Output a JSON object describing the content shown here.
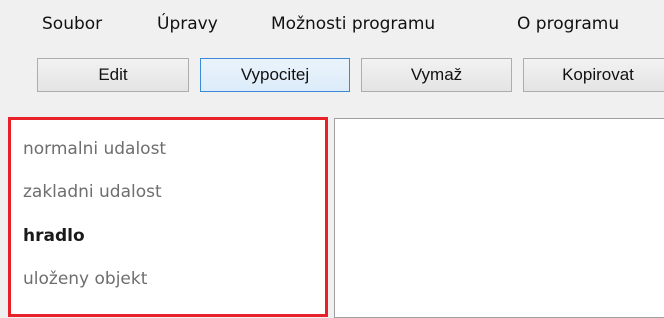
{
  "menubar": {
    "items": [
      {
        "label": "Soubor"
      },
      {
        "label": "Úpravy"
      },
      {
        "label": "Možnosti programu"
      },
      {
        "label": "O programu"
      }
    ]
  },
  "toolbar": {
    "buttons": [
      {
        "label": "Edit"
      },
      {
        "label": "Vypocitej"
      },
      {
        "label": "Vymaž"
      },
      {
        "label": "Kopirovat"
      }
    ]
  },
  "element_list": {
    "items": [
      {
        "label": "normalni udalost"
      },
      {
        "label": "zakladni udalost"
      },
      {
        "label": "hradlo"
      },
      {
        "label": "uloženy objekt"
      }
    ],
    "selected_index": 2
  },
  "colors": {
    "highlight_border": "#e8202a",
    "focused_button_border": "#3c8ad7",
    "muted_text": "#6e6e6e"
  }
}
